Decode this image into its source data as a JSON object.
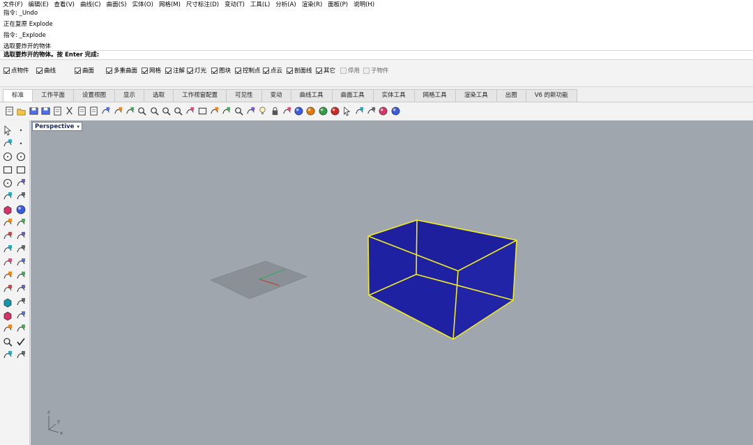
{
  "menubar": {
    "items": [
      "文件(F)",
      "编辑(E)",
      "查看(V)",
      "曲线(C)",
      "曲面(S)",
      "实体(O)",
      "网格(M)",
      "尺寸标注(D)",
      "变动(T)",
      "工具(L)",
      "分析(A)",
      "渲染(R)",
      "面板(P)",
      "说明(H)"
    ]
  },
  "command": {
    "history": [
      "指令: _Undo",
      "正在复原 Explode",
      "指令: _Explode",
      "选取要炸开的物体"
    ],
    "prompt": "选取要炸开的物体。按 Enter 完成:"
  },
  "osnap": {
    "items": [
      {
        "label": "点物件",
        "checked": true
      },
      {
        "label": "曲线",
        "checked": true
      },
      {
        "label": "曲面",
        "checked": true
      },
      {
        "label": "多重曲面",
        "checked": true
      },
      {
        "label": "网格",
        "checked": true
      },
      {
        "label": "注解",
        "checked": true
      },
      {
        "label": "灯光",
        "checked": true
      },
      {
        "label": "图块",
        "checked": true
      },
      {
        "label": "控制点",
        "checked": true
      },
      {
        "label": "点云",
        "checked": true
      },
      {
        "label": "剖面线",
        "checked": true
      },
      {
        "label": "其它",
        "checked": true
      },
      {
        "label": "停用",
        "checked": false
      },
      {
        "label": "子物件",
        "checked": false
      }
    ]
  },
  "tabs": [
    "标准",
    "工作平面",
    "设置视图",
    "显示",
    "选取",
    "工作视窗配置",
    "可见性",
    "变动",
    "曲线工具",
    "曲面工具",
    "实体工具",
    "网格工具",
    "渲染工具",
    "出图",
    "V6 的新功能"
  ],
  "active_tab": "标准",
  "toolbar": {
    "icons": [
      "new-file-icon",
      "open-folder-icon",
      "save-icon",
      "print-icon",
      "import-icon",
      "cut-icon",
      "copy-icon",
      "paste-icon",
      "undo-icon",
      "pan-hand-icon",
      "rotate-view-icon",
      "zoom-icon",
      "zoom-window-icon",
      "zoom-extents-icon",
      "zoom-selected-icon",
      "undo-view-icon",
      "four-views-icon",
      "car-icon",
      "ghosted-icon",
      "zoom-target-icon",
      "named-views-icon",
      "light-bulb-icon",
      "lock-icon",
      "layer-color-icon",
      "material-sphere-icon",
      "render-sphere-icon",
      "display-sphere-icon",
      "blue-sphere-icon",
      "select-filter-icon",
      "gear-icon",
      "group-icon",
      "grasshopper-icon",
      "help-icon"
    ]
  },
  "sidebar": {
    "icons": [
      "select-icon",
      "point-icon",
      "polyline-icon",
      "curve-points-icon",
      "circle-icon",
      "arc-icon",
      "polygon-icon",
      "rectangle-icon",
      "ellipse-icon",
      "curve-fillet-icon",
      "offset-curve-icon",
      "extrude-surface-icon",
      "box-solid-icon",
      "sphere-solid-icon",
      "cylinder-icon",
      "mesh-icon",
      "boolean-icon",
      "explode-icon",
      "dimension-icon",
      "text-dimension-icon",
      "shell-icon",
      "network-icon",
      "fillet-edge-icon",
      "sweep-icon",
      "text-icon",
      "transform-icon",
      "block-icon",
      "split-icon",
      "cage-icon",
      "flow-icon",
      "array-icon",
      "gumball-icon",
      "analysis-icon",
      "check-icon",
      "render-icon",
      "paint-icon"
    ]
  },
  "viewport": {
    "name": "Perspective",
    "axes": {
      "z": "z",
      "y": "y",
      "x": "x"
    }
  },
  "colors": {
    "viewport_bg": "#a0a6ae",
    "box_fill": "#1d1fa0",
    "selection_outline": "#f2ee1c",
    "plane": "#8a9096"
  }
}
